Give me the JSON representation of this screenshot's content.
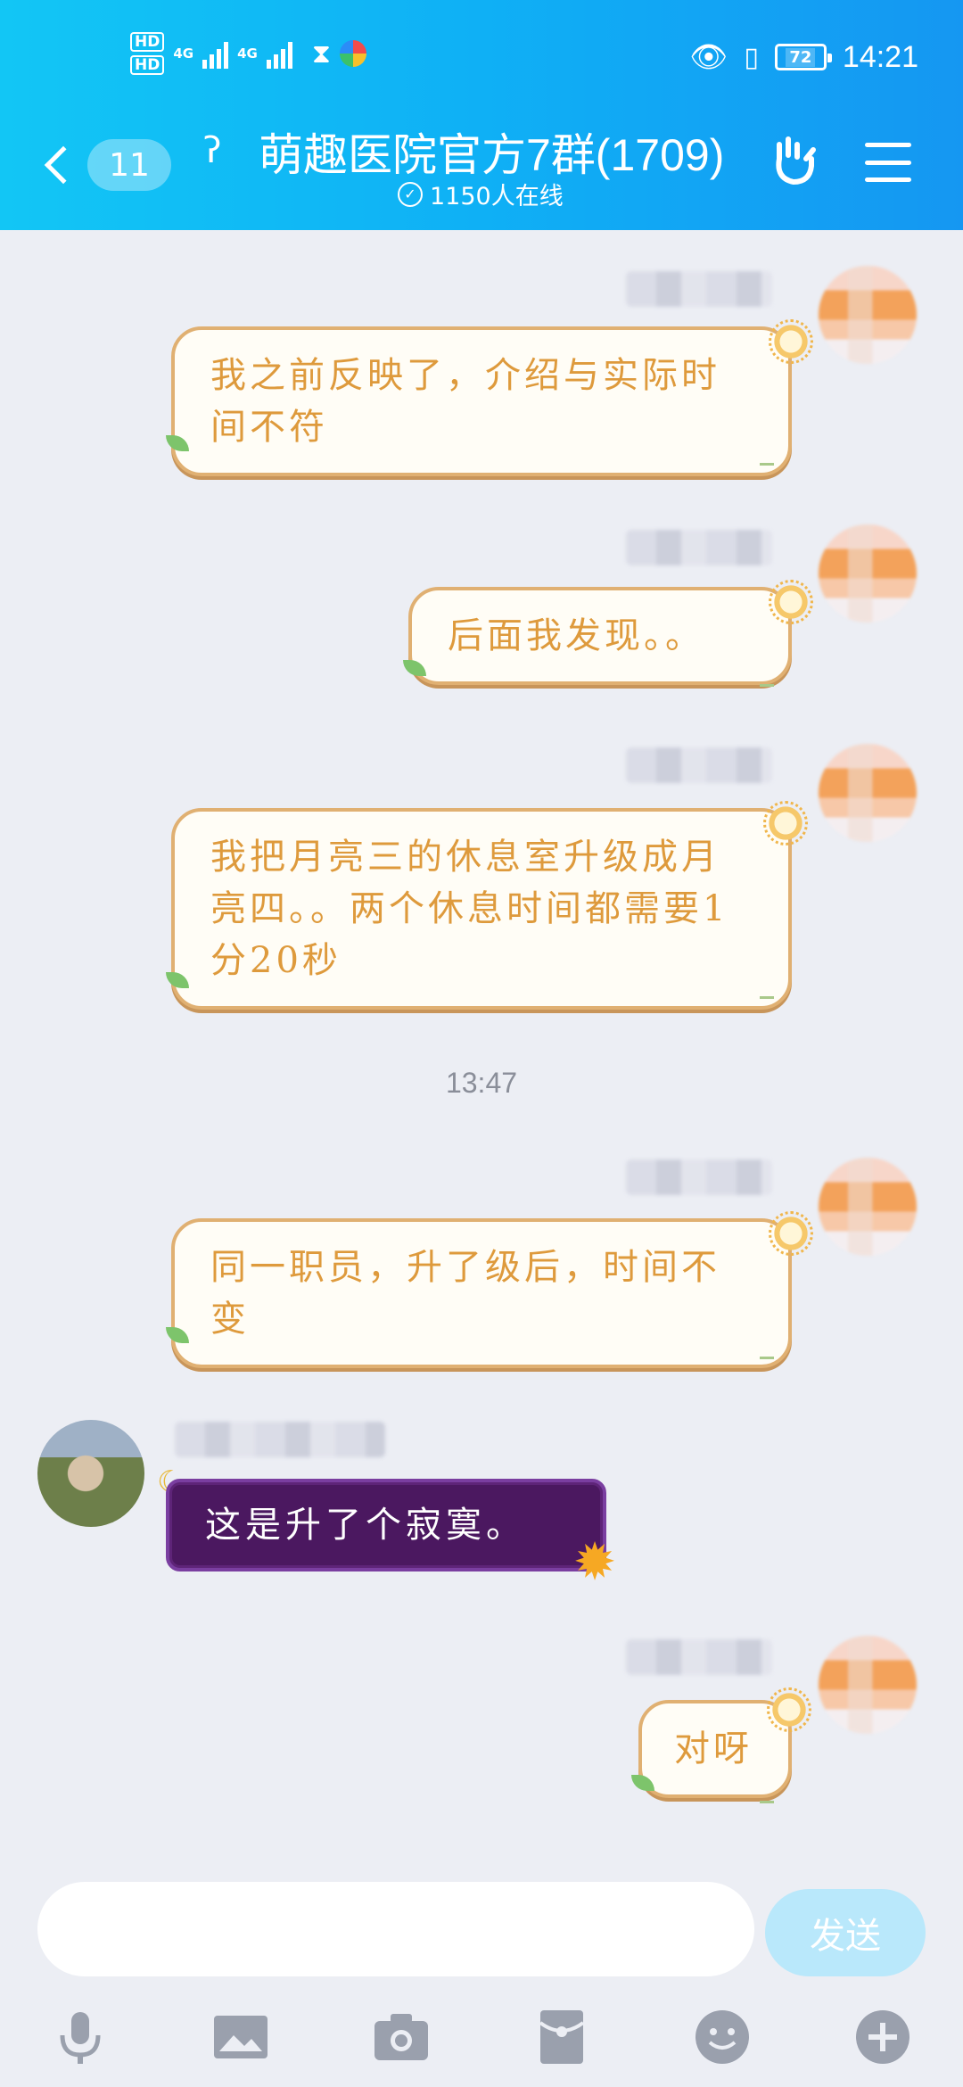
{
  "status_bar": {
    "hd1": "HD",
    "hd2": "HD",
    "net1": "4G",
    "net2": "4G",
    "battery": "72",
    "time": "14:21"
  },
  "header": {
    "unread_count": "11",
    "title": "萌趣医院官方7群(1709)",
    "online": "1150人在线",
    "accent": "#12c6f5"
  },
  "messages": [
    {
      "side": "out",
      "text": "我之前反映了，介绍与实际时间不符"
    },
    {
      "side": "out",
      "text": "后面我发现。。"
    },
    {
      "side": "out",
      "text": "我把月亮三的休息室升级成月亮四。。两个休息时间都需要1分20秒"
    },
    {
      "timestamp": "13:47"
    },
    {
      "side": "out",
      "text": "同一职员，升了级后，时间不变"
    },
    {
      "side": "in",
      "text": "这是升了个寂寞。"
    },
    {
      "side": "out",
      "text": "对呀"
    }
  ],
  "input": {
    "value": "",
    "send_label": "发送"
  },
  "toolbar": {
    "items": [
      "mic-icon",
      "image-icon",
      "camera-icon",
      "red-packet-icon",
      "emoji-icon",
      "plus-icon"
    ]
  }
}
